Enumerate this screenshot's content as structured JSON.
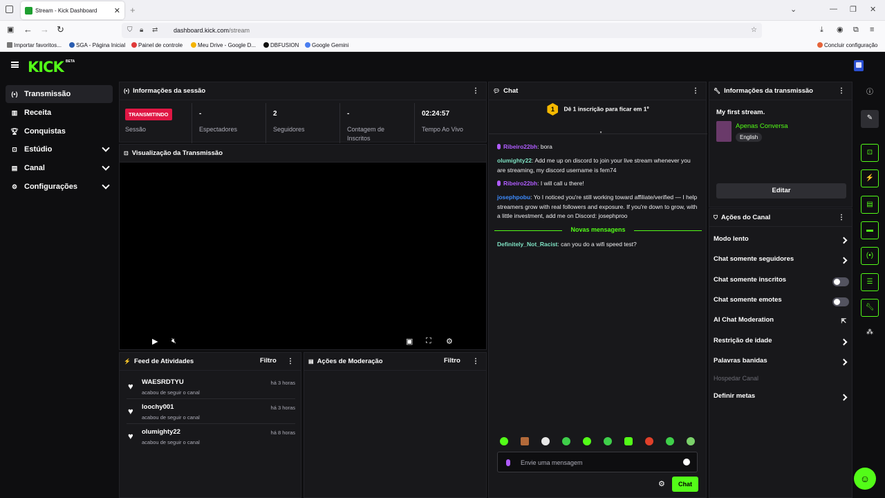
{
  "browser": {
    "tab_title": "Stream - Kick Dashboard",
    "url_domain": "dashboard.kick.com",
    "url_path": "/stream",
    "bookmarks": [
      "Importar favoritos...",
      "SGA - Página Inicial",
      "Painel de controle",
      "Meu Drive - Google D...",
      "DBFUSION",
      "Google Gemini",
      "Concluir configuração"
    ]
  },
  "sidebar": {
    "items": [
      {
        "label": "Transmissão"
      },
      {
        "label": "Receita"
      },
      {
        "label": "Conquistas"
      },
      {
        "label": "Estúdio"
      },
      {
        "label": "Canal"
      },
      {
        "label": "Configurações"
      }
    ]
  },
  "session": {
    "title": "Informações da sessão",
    "badge": "TRANSMITINDO",
    "badge_label": "Sessão",
    "stats": [
      {
        "value": "-",
        "label": "Espectadores"
      },
      {
        "value": "2",
        "label": "Seguidores"
      },
      {
        "value": "-",
        "label": "Contagem de Inscritos"
      },
      {
        "value": "02:24:57",
        "label": "Tempo Ao Vivo"
      }
    ]
  },
  "preview": {
    "title": "Visualização da Transmissão"
  },
  "feed": {
    "title": "Feed de Atividades",
    "filter": "Filtro",
    "items": [
      {
        "user": "WAESRDTYU",
        "action": "acabou de seguir o canal",
        "time": "há 3 horas"
      },
      {
        "user": "loochy001",
        "action": "acabou de seguir o canal",
        "time": "há 3 horas"
      },
      {
        "user": "olumighty22",
        "action": "acabou de seguir o canal",
        "time": "há 8 horas"
      }
    ]
  },
  "moderation": {
    "title": "Ações de Moderação",
    "filter": "Filtro"
  },
  "chat": {
    "title": "Chat",
    "goal": "Dê 1 inscrição para ficar em 1º",
    "goal_rank": "1",
    "messages": [
      {
        "user": "Ribeiro22bh",
        "text": ": bora",
        "color": "#b05cff"
      },
      {
        "user": "olumighty22",
        "text": ": Add me up on discord to join your live stream whenever you are streaming, my discord username is fem74",
        "color": "#7fe3c4"
      },
      {
        "user": "Ribeiro22bh",
        "text": ": I will call u there!",
        "color": "#b05cff"
      },
      {
        "user": "josephpobu",
        "text": ": Yo I noticed you're still working toward affiliate/verified — I help streamers grow with real followers and exposure. If you're down to grow, with a little investment, add me on Discord: josephproo",
        "color": "#3d8bff"
      }
    ],
    "new_label": "Novas mensagens",
    "new_message": {
      "user": "Definitely_Not_Racist",
      "text": ": can you do a wifi speed test?",
      "color": "#7fe3c4"
    },
    "placeholder": "Envie uma mensagem",
    "send": "Chat"
  },
  "stream_info": {
    "title": "Informações da transmissão",
    "stream_title": "My first stream.",
    "category": "Apenas Conversa",
    "language": "English",
    "edit": "Editar"
  },
  "channel_actions": {
    "title": "Ações do Canal",
    "items": [
      {
        "label": "Modo lento",
        "control": "arrow"
      },
      {
        "label": "Chat somente seguidores",
        "control": "arrow"
      },
      {
        "label": "Chat somente inscritos",
        "control": "toggle"
      },
      {
        "label": "Chat somente emotes",
        "control": "toggle"
      },
      {
        "label": "AI Chat Moderation",
        "control": "external"
      },
      {
        "label": "Restrição de idade",
        "control": "arrow"
      },
      {
        "label": "Palavras banidas",
        "control": "arrow"
      },
      {
        "label": "Hospedar Canal",
        "control": "disabled"
      },
      {
        "label": "Definir metas",
        "control": "arrow"
      }
    ]
  },
  "colors": {
    "accent": "#53fc18",
    "live": "#e01744",
    "panel": "#18181b",
    "bg": "#0e0e10"
  }
}
